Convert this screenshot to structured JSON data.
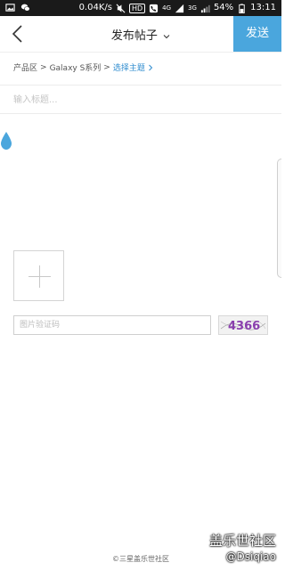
{
  "status_bar": {
    "speed": "0.04K/s",
    "hd_badge": "HD",
    "network_4g": "4G",
    "network_3g": "3G",
    "battery": "54%",
    "time": "13:11"
  },
  "header": {
    "title": "发布帖子",
    "send_label": "发送"
  },
  "breadcrumb": {
    "root": "产品区",
    "sep1": ">",
    "section": "Galaxy S系列",
    "sep2": ">",
    "action": "选择主题"
  },
  "title_field": {
    "placeholder": "输入标题..."
  },
  "captcha": {
    "placeholder": "图片验证码",
    "code": "4366"
  },
  "footer": {
    "copyright": "©三星盖乐世社区"
  },
  "watermark": {
    "line1": "盖乐世社区",
    "line2": "@Dsiqiao"
  },
  "colors": {
    "accent": "#4aa6dd",
    "link": "#2f8ccf",
    "drop": "#4aa6dd"
  },
  "icons": [
    "image-icon",
    "wechat-icon",
    "mute-icon",
    "signal-icon",
    "battery-icon",
    "back-arrow-icon",
    "chevron-down-icon",
    "chevron-right-icon",
    "drop-icon",
    "plus-icon"
  ]
}
